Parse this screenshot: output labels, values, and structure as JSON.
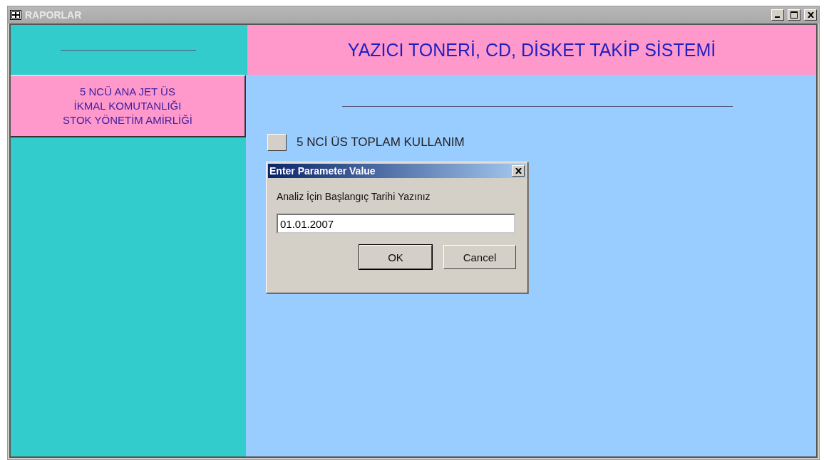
{
  "window": {
    "title": "RAPORLAR"
  },
  "header": {
    "title": "YAZICI TONERİ, CD, DİSKET TAKİP SİSTEMİ"
  },
  "sidebar": {
    "unit_lines": [
      "5 NCÜ ANA JET ÜS",
      "İKMAL KOMUTANLIĞI",
      "STOK YÖNETİM AMİRLİĞİ"
    ]
  },
  "report_buttons": [
    {
      "label": "5 NCİ ÜS TOPLAM KULLANIM"
    }
  ],
  "dialog": {
    "title": "Enter Parameter Value",
    "prompt": "Analiz İçin Başlangıç Tarihi Yazınız",
    "value": "01.01.2007",
    "buttons": [
      {
        "label": "OK",
        "default": true
      },
      {
        "label": "Cancel",
        "default": false
      }
    ]
  }
}
